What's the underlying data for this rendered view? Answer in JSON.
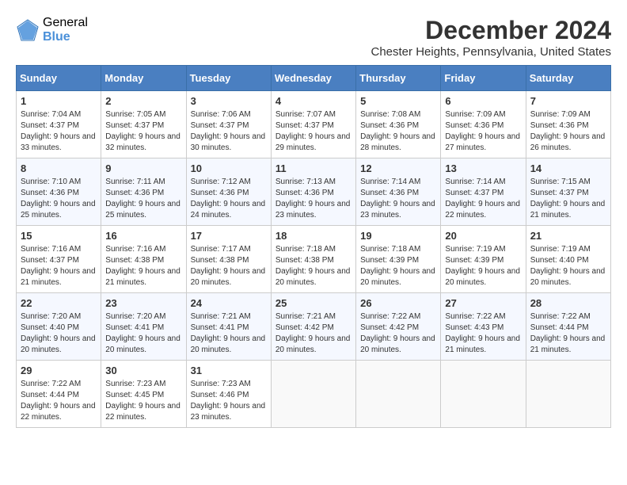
{
  "logo": {
    "general": "General",
    "blue": "Blue"
  },
  "title": {
    "month": "December 2024",
    "location": "Chester Heights, Pennsylvania, United States"
  },
  "calendar": {
    "headers": [
      "Sunday",
      "Monday",
      "Tuesday",
      "Wednesday",
      "Thursday",
      "Friday",
      "Saturday"
    ],
    "weeks": [
      [
        {
          "day": "1",
          "sunrise": "7:04 AM",
          "sunset": "4:37 PM",
          "daylight": "9 hours and 33 minutes."
        },
        {
          "day": "2",
          "sunrise": "7:05 AM",
          "sunset": "4:37 PM",
          "daylight": "9 hours and 32 minutes."
        },
        {
          "day": "3",
          "sunrise": "7:06 AM",
          "sunset": "4:37 PM",
          "daylight": "9 hours and 30 minutes."
        },
        {
          "day": "4",
          "sunrise": "7:07 AM",
          "sunset": "4:37 PM",
          "daylight": "9 hours and 29 minutes."
        },
        {
          "day": "5",
          "sunrise": "7:08 AM",
          "sunset": "4:36 PM",
          "daylight": "9 hours and 28 minutes."
        },
        {
          "day": "6",
          "sunrise": "7:09 AM",
          "sunset": "4:36 PM",
          "daylight": "9 hours and 27 minutes."
        },
        {
          "day": "7",
          "sunrise": "7:09 AM",
          "sunset": "4:36 PM",
          "daylight": "9 hours and 26 minutes."
        }
      ],
      [
        {
          "day": "8",
          "sunrise": "7:10 AM",
          "sunset": "4:36 PM",
          "daylight": "9 hours and 25 minutes."
        },
        {
          "day": "9",
          "sunrise": "7:11 AM",
          "sunset": "4:36 PM",
          "daylight": "9 hours and 25 minutes."
        },
        {
          "day": "10",
          "sunrise": "7:12 AM",
          "sunset": "4:36 PM",
          "daylight": "9 hours and 24 minutes."
        },
        {
          "day": "11",
          "sunrise": "7:13 AM",
          "sunset": "4:36 PM",
          "daylight": "9 hours and 23 minutes."
        },
        {
          "day": "12",
          "sunrise": "7:14 AM",
          "sunset": "4:36 PM",
          "daylight": "9 hours and 23 minutes."
        },
        {
          "day": "13",
          "sunrise": "7:14 AM",
          "sunset": "4:37 PM",
          "daylight": "9 hours and 22 minutes."
        },
        {
          "day": "14",
          "sunrise": "7:15 AM",
          "sunset": "4:37 PM",
          "daylight": "9 hours and 21 minutes."
        }
      ],
      [
        {
          "day": "15",
          "sunrise": "7:16 AM",
          "sunset": "4:37 PM",
          "daylight": "9 hours and 21 minutes."
        },
        {
          "day": "16",
          "sunrise": "7:16 AM",
          "sunset": "4:38 PM",
          "daylight": "9 hours and 21 minutes."
        },
        {
          "day": "17",
          "sunrise": "7:17 AM",
          "sunset": "4:38 PM",
          "daylight": "9 hours and 20 minutes."
        },
        {
          "day": "18",
          "sunrise": "7:18 AM",
          "sunset": "4:38 PM",
          "daylight": "9 hours and 20 minutes."
        },
        {
          "day": "19",
          "sunrise": "7:18 AM",
          "sunset": "4:39 PM",
          "daylight": "9 hours and 20 minutes."
        },
        {
          "day": "20",
          "sunrise": "7:19 AM",
          "sunset": "4:39 PM",
          "daylight": "9 hours and 20 minutes."
        },
        {
          "day": "21",
          "sunrise": "7:19 AM",
          "sunset": "4:40 PM",
          "daylight": "9 hours and 20 minutes."
        }
      ],
      [
        {
          "day": "22",
          "sunrise": "7:20 AM",
          "sunset": "4:40 PM",
          "daylight": "9 hours and 20 minutes."
        },
        {
          "day": "23",
          "sunrise": "7:20 AM",
          "sunset": "4:41 PM",
          "daylight": "9 hours and 20 minutes."
        },
        {
          "day": "24",
          "sunrise": "7:21 AM",
          "sunset": "4:41 PM",
          "daylight": "9 hours and 20 minutes."
        },
        {
          "day": "25",
          "sunrise": "7:21 AM",
          "sunset": "4:42 PM",
          "daylight": "9 hours and 20 minutes."
        },
        {
          "day": "26",
          "sunrise": "7:22 AM",
          "sunset": "4:42 PM",
          "daylight": "9 hours and 20 minutes."
        },
        {
          "day": "27",
          "sunrise": "7:22 AM",
          "sunset": "4:43 PM",
          "daylight": "9 hours and 21 minutes."
        },
        {
          "day": "28",
          "sunrise": "7:22 AM",
          "sunset": "4:44 PM",
          "daylight": "9 hours and 21 minutes."
        }
      ],
      [
        {
          "day": "29",
          "sunrise": "7:22 AM",
          "sunset": "4:44 PM",
          "daylight": "9 hours and 22 minutes."
        },
        {
          "day": "30",
          "sunrise": "7:23 AM",
          "sunset": "4:45 PM",
          "daylight": "9 hours and 22 minutes."
        },
        {
          "day": "31",
          "sunrise": "7:23 AM",
          "sunset": "4:46 PM",
          "daylight": "9 hours and 23 minutes."
        },
        null,
        null,
        null,
        null
      ]
    ]
  }
}
